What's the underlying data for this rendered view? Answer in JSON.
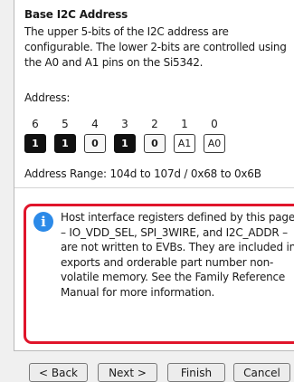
{
  "section": {
    "title": "Base I2C Address",
    "description": "The upper 5-bits of the I2C address are configurable. The lower 2-bits are controlled using the A0 and A1 pins on the Si5342.",
    "address_label": "Address:",
    "bits": [
      {
        "number": "6",
        "value": "1",
        "state": "on"
      },
      {
        "number": "5",
        "value": "1",
        "state": "on"
      },
      {
        "number": "4",
        "value": "0",
        "state": "off"
      },
      {
        "number": "3",
        "value": "1",
        "state": "on"
      },
      {
        "number": "2",
        "value": "0",
        "state": "off"
      },
      {
        "number": "1",
        "value": "A1",
        "state": "pin"
      },
      {
        "number": "0",
        "value": "A0",
        "state": "pin"
      }
    ],
    "address_range": "Address Range:  104d to 107d / 0x68 to 0x6B"
  },
  "note": {
    "icon": "info-icon",
    "icon_glyph": "i",
    "text": "Host interface registers defined by this page – IO_VDD_SEL, SPI_3WIRE, and I2C_ADDR – are not written to EVBs. They are included in exports and orderable part number non-volatile memory. See the Family Reference Manual for more information.",
    "highlight_color": "#e0152b",
    "icon_color": "#2c8ae8"
  },
  "buttons": {
    "back": "< Back",
    "next": "Next >",
    "finish": "Finish",
    "cancel": "Cancel"
  }
}
